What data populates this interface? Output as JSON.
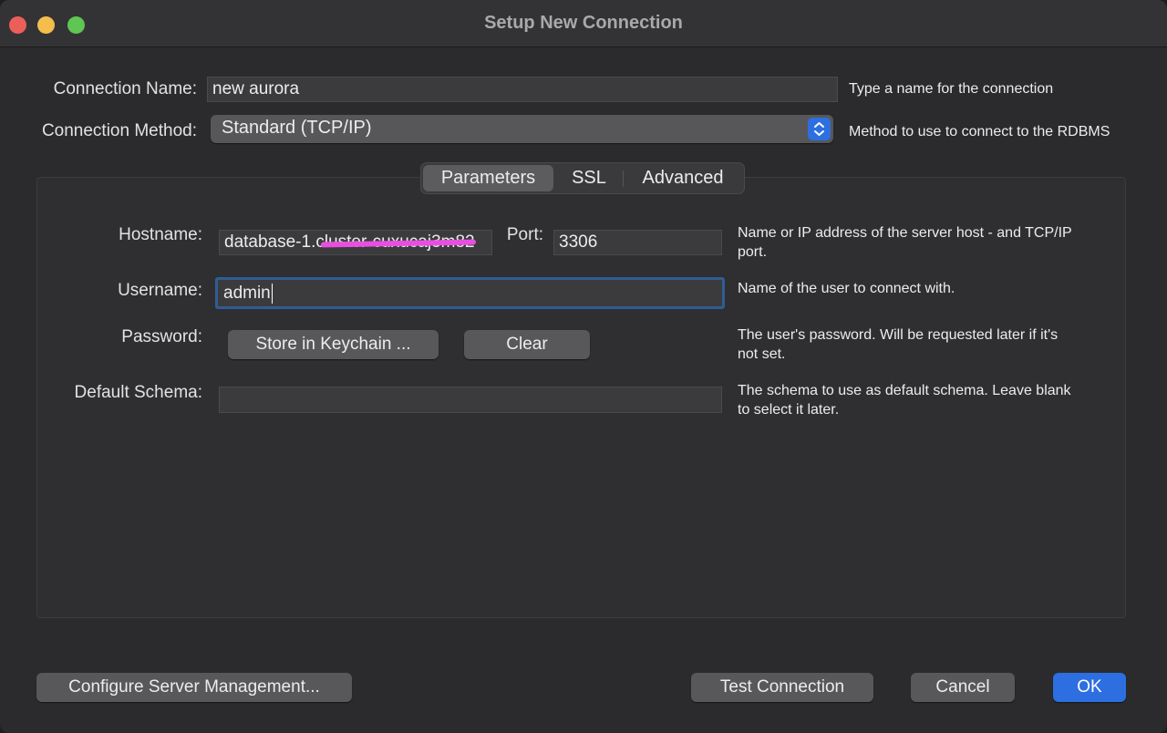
{
  "window": {
    "title": "Setup New Connection"
  },
  "connection_name": {
    "label": "Connection Name:",
    "value": "new aurora",
    "hint": "Type a name for the connection"
  },
  "connection_method": {
    "label": "Connection Method:",
    "selected": "Standard (TCP/IP)",
    "hint": "Method to use to connect to the RDBMS"
  },
  "tabs": [
    {
      "label": "Parameters",
      "active": true
    },
    {
      "label": "SSL",
      "active": false
    },
    {
      "label": "Advanced",
      "active": false
    }
  ],
  "parameters": {
    "hostname": {
      "label": "Hostname:",
      "value": "database-1.cluster-cuxucaj3m82",
      "hint_line1": "Name or IP address of the server host - and TCP/IP",
      "hint_line2": "port."
    },
    "port": {
      "label": "Port:",
      "value": "3306"
    },
    "username": {
      "label": "Username:",
      "value": "admin",
      "hint": "Name of the user to connect with."
    },
    "password": {
      "label": "Password:",
      "store_button": "Store in Keychain ...",
      "clear_button": "Clear",
      "hint_line1": "The user's password. Will be requested later if it's",
      "hint_line2": "not set."
    },
    "default_schema": {
      "label": "Default Schema:",
      "value": "",
      "hint_line1": "The schema to use as default schema. Leave blank",
      "hint_line2": "to select it later."
    }
  },
  "footer": {
    "configure_button": "Configure Server Management...",
    "test_button": "Test Connection",
    "cancel_button": "Cancel",
    "ok_button": "OK"
  },
  "colors": {
    "accent": "#2d6fe0",
    "redaction": "#e84fe0"
  }
}
